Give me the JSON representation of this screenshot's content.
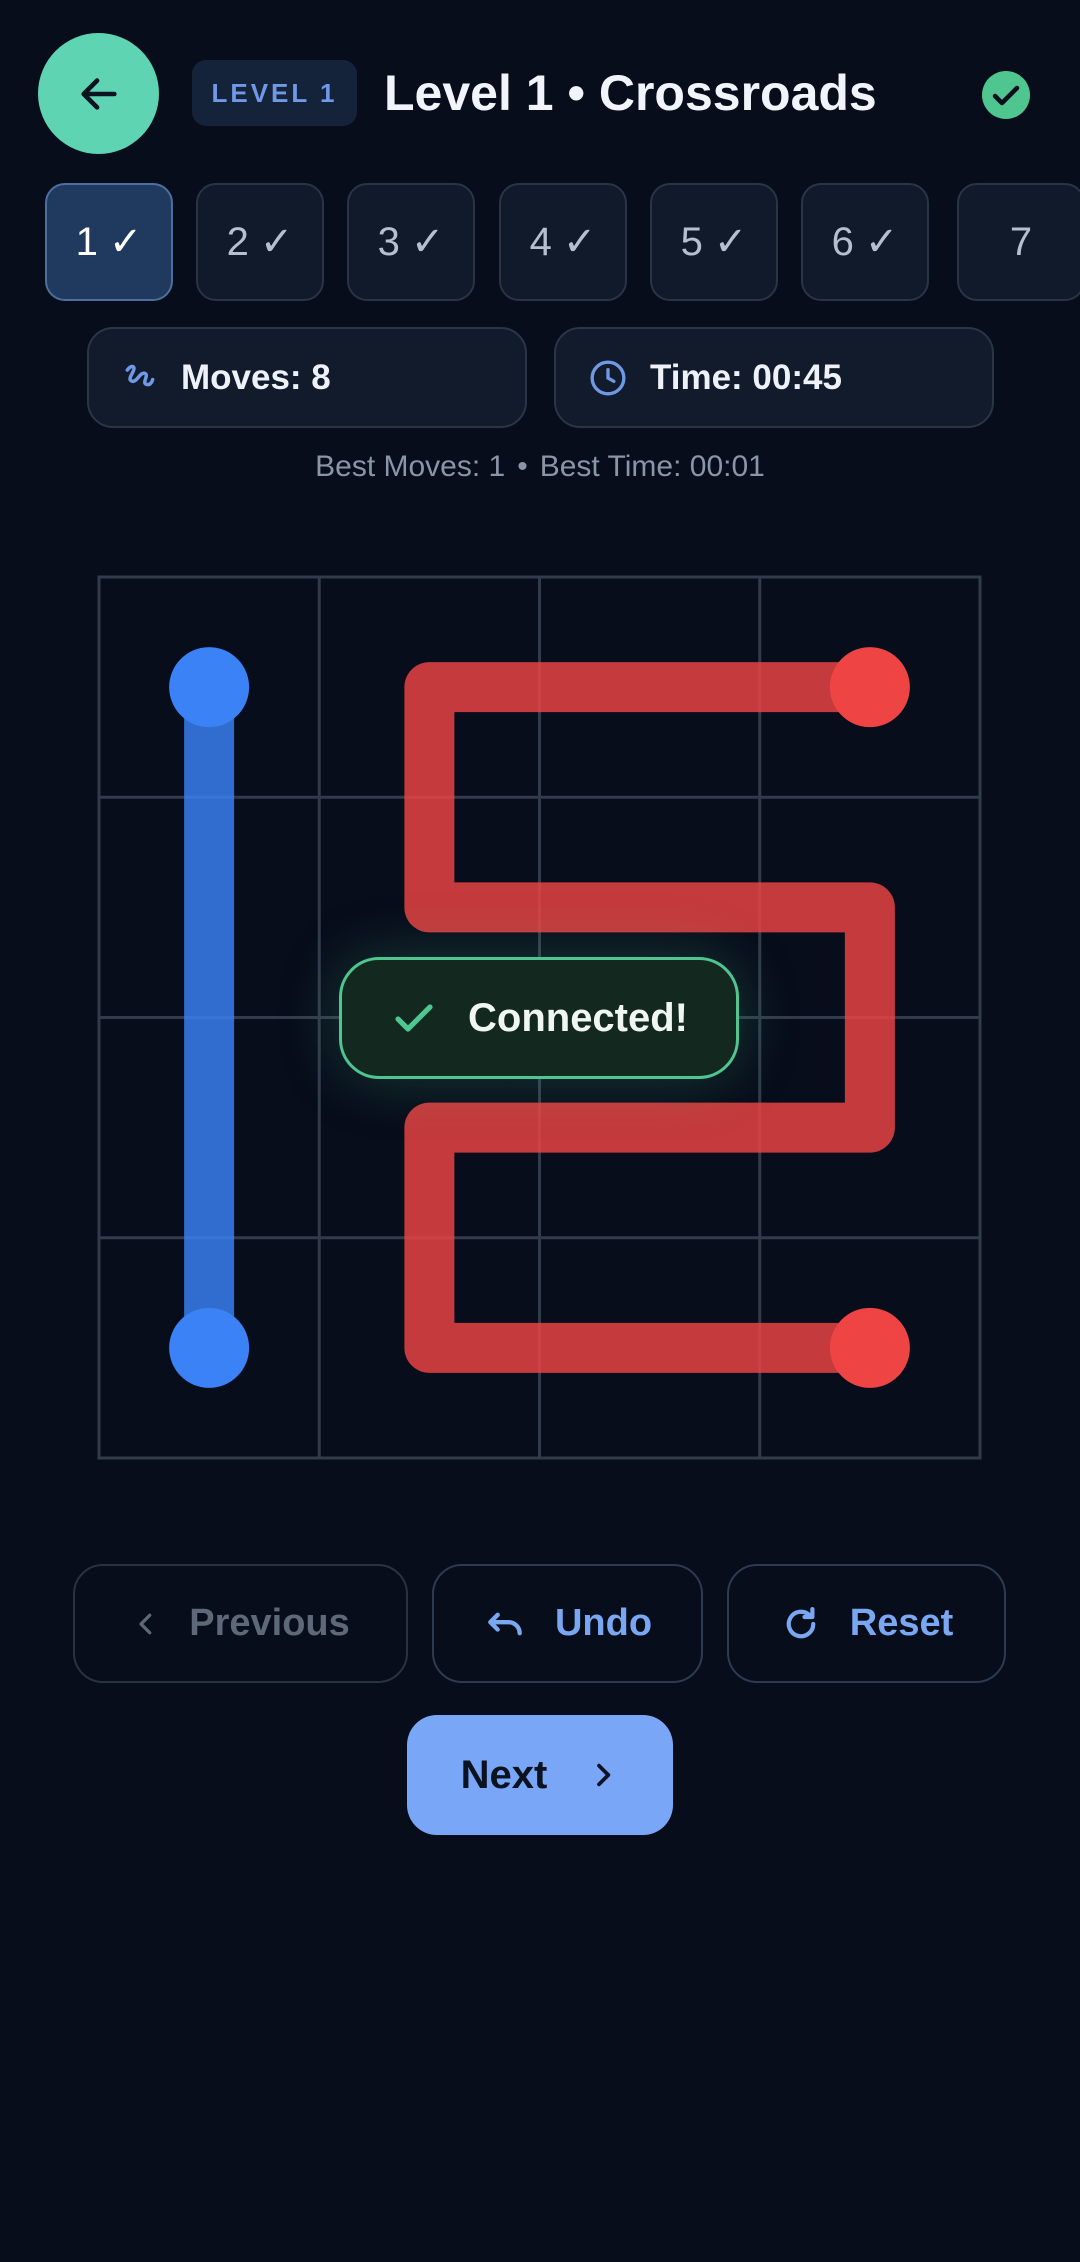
{
  "header": {
    "level_badge": "LEVEL 1",
    "title": "Level 1 • Crossroads",
    "back_icon": "arrow-left-icon",
    "status_icon": "check-circle-icon"
  },
  "levels": [
    {
      "label": "1 ✓",
      "active": true
    },
    {
      "label": "2 ✓",
      "active": false
    },
    {
      "label": "3 ✓",
      "active": false
    },
    {
      "label": "4 ✓",
      "active": false
    },
    {
      "label": "5 ✓",
      "active": false
    },
    {
      "label": "6 ✓",
      "active": false
    },
    {
      "label": "7",
      "active": false
    }
  ],
  "stats": {
    "moves": "Moves: 8",
    "time": "Time: 00:45"
  },
  "best": {
    "moves": "Best Moves: 1",
    "separator": "•",
    "time": "Best Time: 00:01"
  },
  "board": {
    "rows": 4,
    "cols": 4,
    "paths": [
      {
        "color": "#3b82f6",
        "cells": [
          [
            0,
            0
          ],
          [
            1,
            0
          ],
          [
            2,
            0
          ],
          [
            3,
            0
          ]
        ]
      },
      {
        "color": "#ef4444",
        "cells": [
          [
            0,
            3
          ],
          [
            0,
            2
          ],
          [
            0,
            1
          ],
          [
            1,
            1
          ],
          [
            1,
            2
          ],
          [
            1,
            3
          ],
          [
            2,
            3
          ],
          [
            2,
            2
          ],
          [
            2,
            1
          ],
          [
            3,
            1
          ],
          [
            3,
            2
          ],
          [
            3,
            3
          ]
        ]
      }
    ]
  },
  "toast": {
    "text": "Connected!",
    "icon": "check-icon"
  },
  "controls": {
    "previous": "Previous",
    "undo": "Undo",
    "reset": "Reset",
    "next": "Next"
  },
  "colors": {
    "accent": "#5ed4b3",
    "primary": "#7aa6f7",
    "blue_path": "#3b82f6",
    "red_path": "#ef4444",
    "success": "#4fc58f"
  }
}
